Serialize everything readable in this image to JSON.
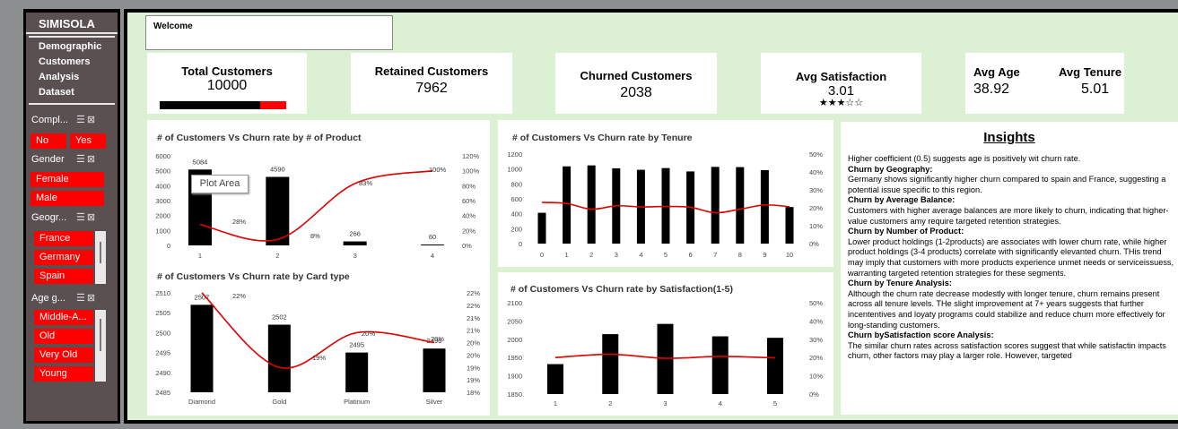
{
  "sidebar": {
    "brand": "SIMISOLA",
    "nav": [
      "Demographic",
      "Customers",
      "Analysis",
      "Dataset"
    ],
    "slicers": [
      {
        "label": "Compl...",
        "items": [
          "No",
          "Yes"
        ]
      },
      {
        "label": "Gender",
        "items": [
          "Female",
          "Male"
        ]
      },
      {
        "label": "Geogr...",
        "items": [
          "France",
          "Germany",
          "Spain"
        ]
      },
      {
        "label": "Age g...",
        "items": [
          "Middle-A...",
          "Old",
          "Very Old",
          "Young"
        ]
      }
    ],
    "slicer_icons": "☰ ⊠"
  },
  "welcome": "Welcome",
  "kpis": {
    "total": {
      "title": "Total Customers",
      "value": "10000",
      "retained_fraction": 0.797
    },
    "retained": {
      "title": "Retained Customers",
      "value": "7962"
    },
    "churned": {
      "title": "Churned Customers",
      "value": "2038"
    },
    "satisfaction": {
      "title": "Avg Satisfaction",
      "value": "3.01",
      "stars": "★★★☆☆"
    },
    "age": {
      "title": "Avg Age",
      "value": "38.92"
    },
    "tenure": {
      "title": "Avg Tenure",
      "value": "5.01"
    }
  },
  "tooltip": "Plot Area",
  "chart_data": [
    {
      "type": "bar",
      "title": "# of Customers Vs Churn rate by # of Product",
      "categories": [
        "1",
        "2",
        "3",
        "4"
      ],
      "series": [
        {
          "values": [
            5084,
            4590,
            266,
            60
          ]
        }
      ],
      "line_values": [
        28,
        8,
        83,
        100
      ],
      "bar_labels": [
        "5084",
        "4590",
        "266",
        "60"
      ],
      "line_labels": [
        "28%",
        "8%",
        "83%",
        "100%"
      ],
      "ylim": [
        0,
        6000
      ],
      "yticks": [
        "6000",
        "5000",
        "4000",
        "3000",
        "2000",
        "1000",
        "0"
      ],
      "y2lim": [
        0,
        120
      ],
      "y2ticks": [
        "120%",
        "100%",
        "80%",
        "60%",
        "40%",
        "20%",
        "0%"
      ]
    },
    {
      "type": "bar",
      "title": "# of Customers Vs Churn rate by Card type",
      "categories": [
        "Diamond",
        "Gold",
        "Platinum",
        "Silver"
      ],
      "series": [
        {
          "values": [
            2507,
            2502,
            2495,
            2496
          ]
        }
      ],
      "line_values": [
        22,
        19,
        20.4,
        20
      ],
      "bar_labels": [
        "2507",
        "2502",
        "2495",
        "2496"
      ],
      "line_labels": [
        "22%",
        "19%",
        "20%",
        "20%"
      ],
      "ylim": [
        2485,
        2510
      ],
      "yticks": [
        "2510",
        "2505",
        "2500",
        "2495",
        "2490",
        "2485"
      ],
      "y2lim": [
        18,
        22
      ],
      "y2ticks": [
        "22%",
        "22%",
        "21%",
        "21%",
        "20%",
        "20%",
        "19%",
        "19%",
        "18%"
      ]
    },
    {
      "type": "bar",
      "title": "# of Customers Vs Churn rate by Tenure",
      "categories": [
        "0",
        "1",
        "2",
        "3",
        "4",
        "5",
        "6",
        "7",
        "8",
        "9",
        "10"
      ],
      "series": [
        {
          "values": [
            413,
            1035,
            1048,
            1009,
            989,
            1012,
            967,
            1028,
            1025,
            984,
            490
          ]
        }
      ],
      "line_values": [
        23,
        22.4,
        19.2,
        21.1,
        20.5,
        20.7,
        20.3,
        17.2,
        19.2,
        21.6,
        20.6
      ],
      "ylim": [
        0,
        1200
      ],
      "yticks": [
        "1200",
        "1000",
        "800",
        "600",
        "400",
        "200",
        "0"
      ],
      "y2lim": [
        0,
        50
      ],
      "y2ticks": [
        "50%",
        "40%",
        "30%",
        "20%",
        "10%",
        "0%"
      ]
    },
    {
      "type": "bar",
      "title": "# of Customers Vs Churn rate by Satisfaction(1-5)",
      "categories": [
        "1",
        "2",
        "3",
        "4",
        "5"
      ],
      "series": [
        {
          "values": [
            1932,
            2014,
            2042,
            2008,
            2004
          ]
        }
      ],
      "line_values": [
        20,
        21.8,
        19.6,
        20.6,
        19.8
      ],
      "ylim": [
        1850,
        2100
      ],
      "yticks": [
        "2100",
        "2050",
        "2000",
        "1950",
        "1900",
        "1850"
      ],
      "y2lim": [
        0,
        50
      ],
      "y2ticks": [
        "50%",
        "40%",
        "30%",
        "20%",
        "10%",
        "0%"
      ]
    }
  ],
  "insights": {
    "title": "Insights",
    "paragraphs": [
      {
        "head": "",
        "text": "Higher coefficient (0.5) suggests age is positively wit churn rate."
      },
      {
        "head": "Churn by Geography:",
        "text": "Germany shows significantly higher churn compared to spain and France, suggesting a potential issue specific to this region."
      },
      {
        "head": "Churn by Average Balance:",
        "text": "Customers with higher average balances are more likely to churn, indicating that higher-value customers amy require targeted retention strategies."
      },
      {
        "head": "Churn by Number of Product:",
        "text": "Lower product holdings (1-2products) are associates with lower churn rate, while higher product holdings (3-4 products) correlate with significantly elevanted churn. THis trend may imply that customers with more products experience unmet needs or serviceissuess, warranting targeted retention strategies for these segments."
      },
      {
        "head": "Churn by Tenure Analysis:",
        "text": "Although the churn rate decrease modestly with longer tenure, churn remains present across all tenure levels. THe slight improvement at 7+ years suggests that further incententives and loyaty programs could stabilize and reduce churn more effectively for long-standing customers."
      },
      {
        "head": "Churn bySatisfaction score Analysis:",
        "text": "The similar churn rates across satisfaction scores suggest that while satisfactin impacts churn, other factors may play a larger role. However, targeted"
      }
    ]
  }
}
